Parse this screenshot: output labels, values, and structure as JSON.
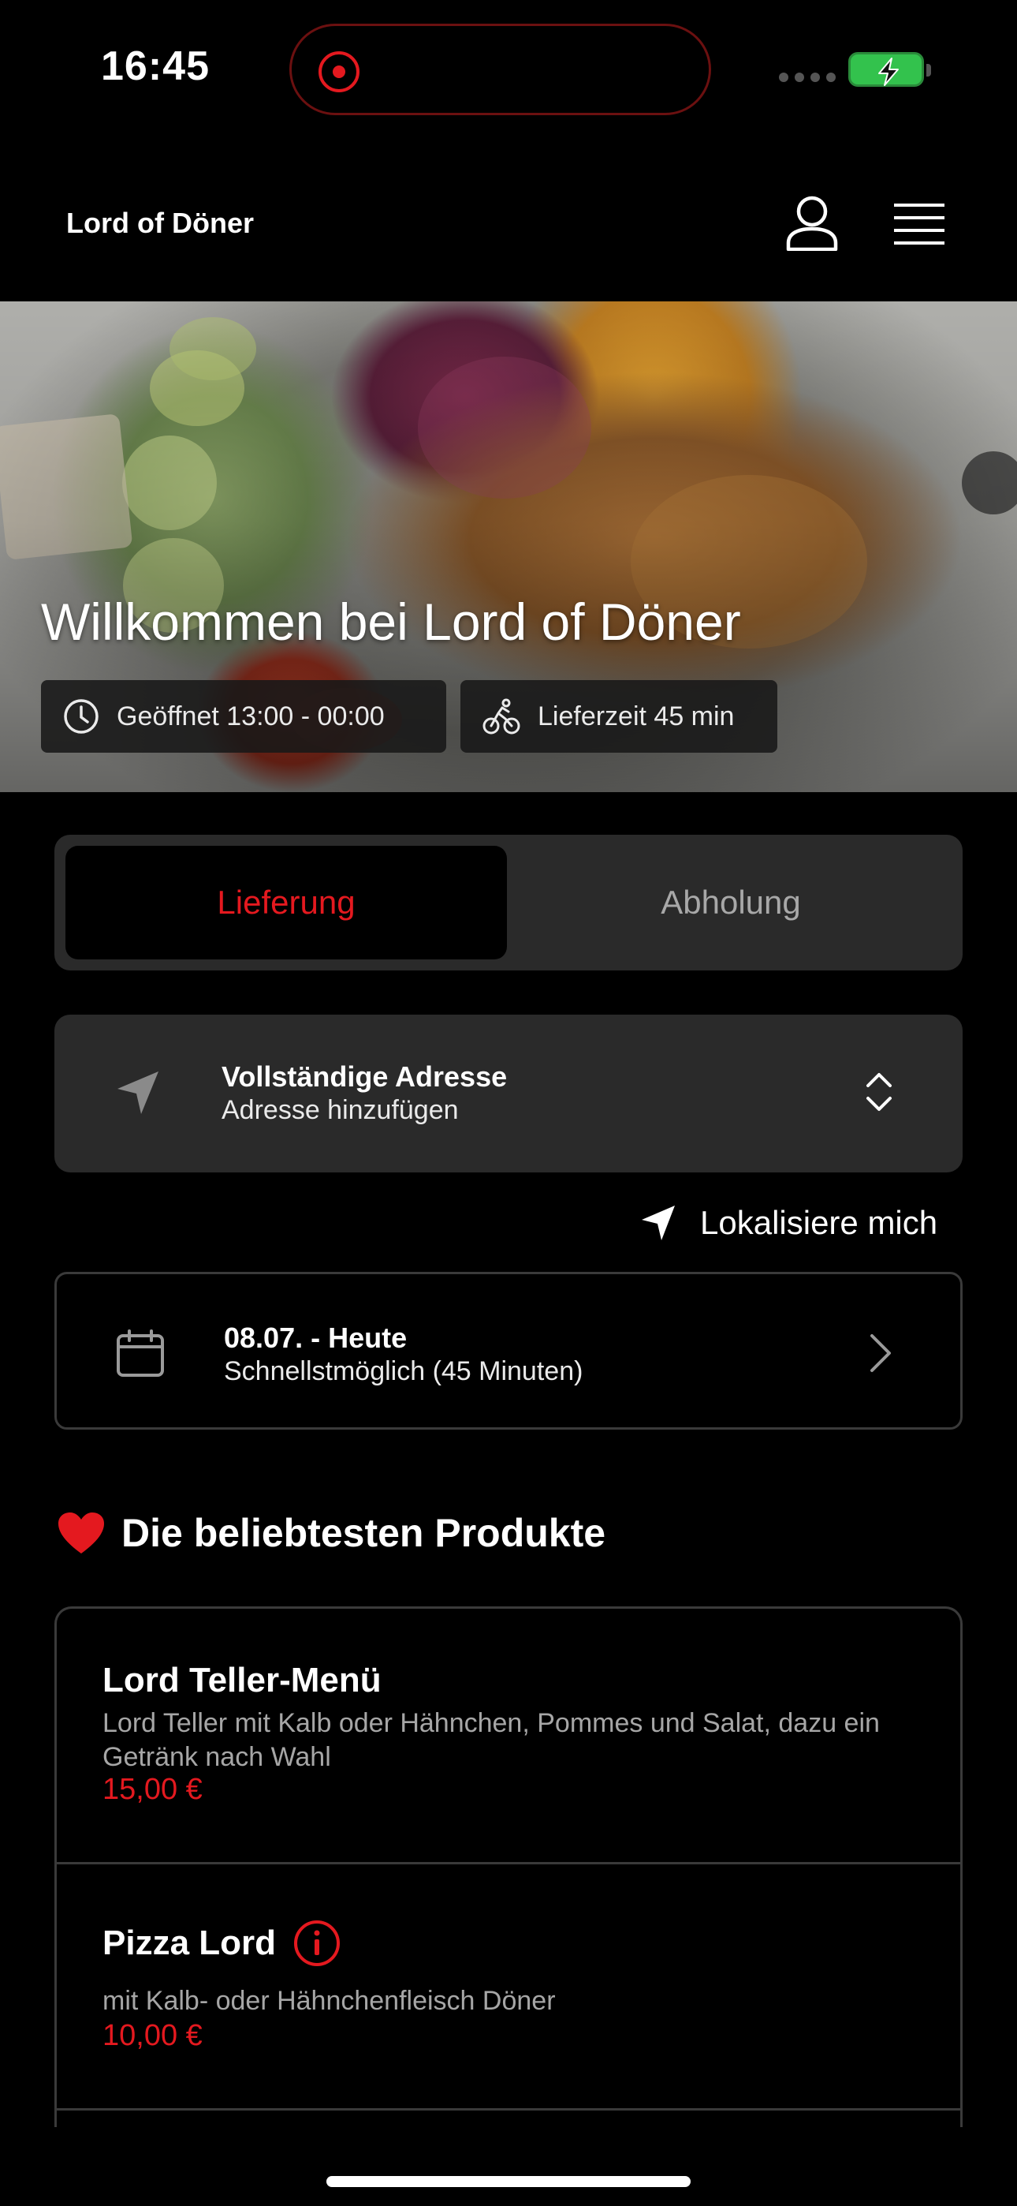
{
  "status_bar": {
    "time": "16:45",
    "battery_color": "#33c24d",
    "recording_color": "#e4191f"
  },
  "header": {
    "brand": "Lord of Döner",
    "profile_icon": "user-icon",
    "menu_icon": "hamburger-menu-icon"
  },
  "hero": {
    "title": "Willkommen bei Lord of Döner",
    "opening_hours": "Geöffnet 13:00 - 00:00",
    "delivery_time": "Lieferzeit 45 min"
  },
  "order_mode": {
    "options": [
      "Lieferung",
      "Abholung"
    ],
    "selected": "Lieferung",
    "active_color": "#e4191f"
  },
  "address": {
    "title": "Vollständige Adresse",
    "subtitle": "Adresse hinzufügen"
  },
  "locate": {
    "label": "Lokalisiere mich"
  },
  "schedule": {
    "date": "08.07. - Heute",
    "time": "Schnellstmöglich (45 Minuten)"
  },
  "popular": {
    "title": "Die beliebtesten Produkte",
    "products": [
      {
        "name": "Lord Teller-Menü",
        "description": "Lord Teller mit Kalb oder Hähnchen, Pommes und Salat, dazu ein Getränk nach Wahl",
        "price": "15,00 €"
      },
      {
        "name": "Pizza Lord",
        "description": "mit Kalb- oder Hähnchenfleisch Döner",
        "price": "10,00 €"
      }
    ]
  },
  "accent_color": "#e4191f"
}
